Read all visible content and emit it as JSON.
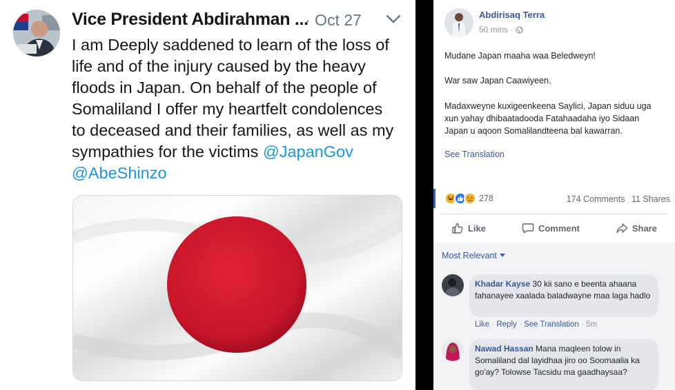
{
  "tweet": {
    "author_name": "Vice President Abdirahman ...",
    "date": "· Oct 27",
    "body_lines": [
      "I am Deeply saddened to learn of the loss of",
      "life and of the injury caused by the heavy",
      "floods in Japan. On behalf of the people of",
      "Somaliland I offer my heartfelt condolences",
      "to deceased and their families, as well as my",
      "sympathies for the victims "
    ],
    "mention_1": "@JapanGov",
    "mention_2": "@AbeShinzo",
    "colors": {
      "mention": "#1b95e0",
      "flag_red": "#d3182b"
    }
  },
  "post": {
    "author": "Abdirisaq Terra",
    "time": "50 mins ·",
    "paragraph_1": "Mudane Japan maaha waa Beledweyn!",
    "paragraph_2": "War saw Japan Caawiyeen.",
    "paragraph_3": "Madaxweyne kuxigeenkeena Saylici, Japan siduu uga xun yahay dhibaatadooda Fatahaadaha iyo Sidaan Japan u aqoon Somalilandteena bal kawarran.",
    "see_translation": "See Translation",
    "reaction_count": "278",
    "comments_count": "174 Comments",
    "shares_count": "11 Shares",
    "like_label": "Like",
    "comment_label": "Comment",
    "share_label": "Share",
    "icons": [
      "globe-icon",
      "haha-reaction-icon",
      "like-reaction-icon",
      "sad-reaction-icon",
      "thumbs-up-icon",
      "speech-bubble-icon",
      "share-arrow-icon",
      "caret-down-icon"
    ]
  },
  "comments": {
    "sort_label": "Most Relevant",
    "items": [
      {
        "name": "Khadar Kayse",
        "text": "30 kii sano e beenta ahaana fahanayee xaalada baladwayne maa laga hadlo",
        "like": "Like",
        "reply": "Reply",
        "see_translation": "See Translation",
        "time": "5m"
      },
      {
        "name": "Nawad Hassan",
        "text": "Mana maqleen tolow in Somaliland dal layidhaa jiro oo Soomaalia ka go'ay? Tolowse Tacsidu ma gaadhaysaa?"
      }
    ]
  }
}
